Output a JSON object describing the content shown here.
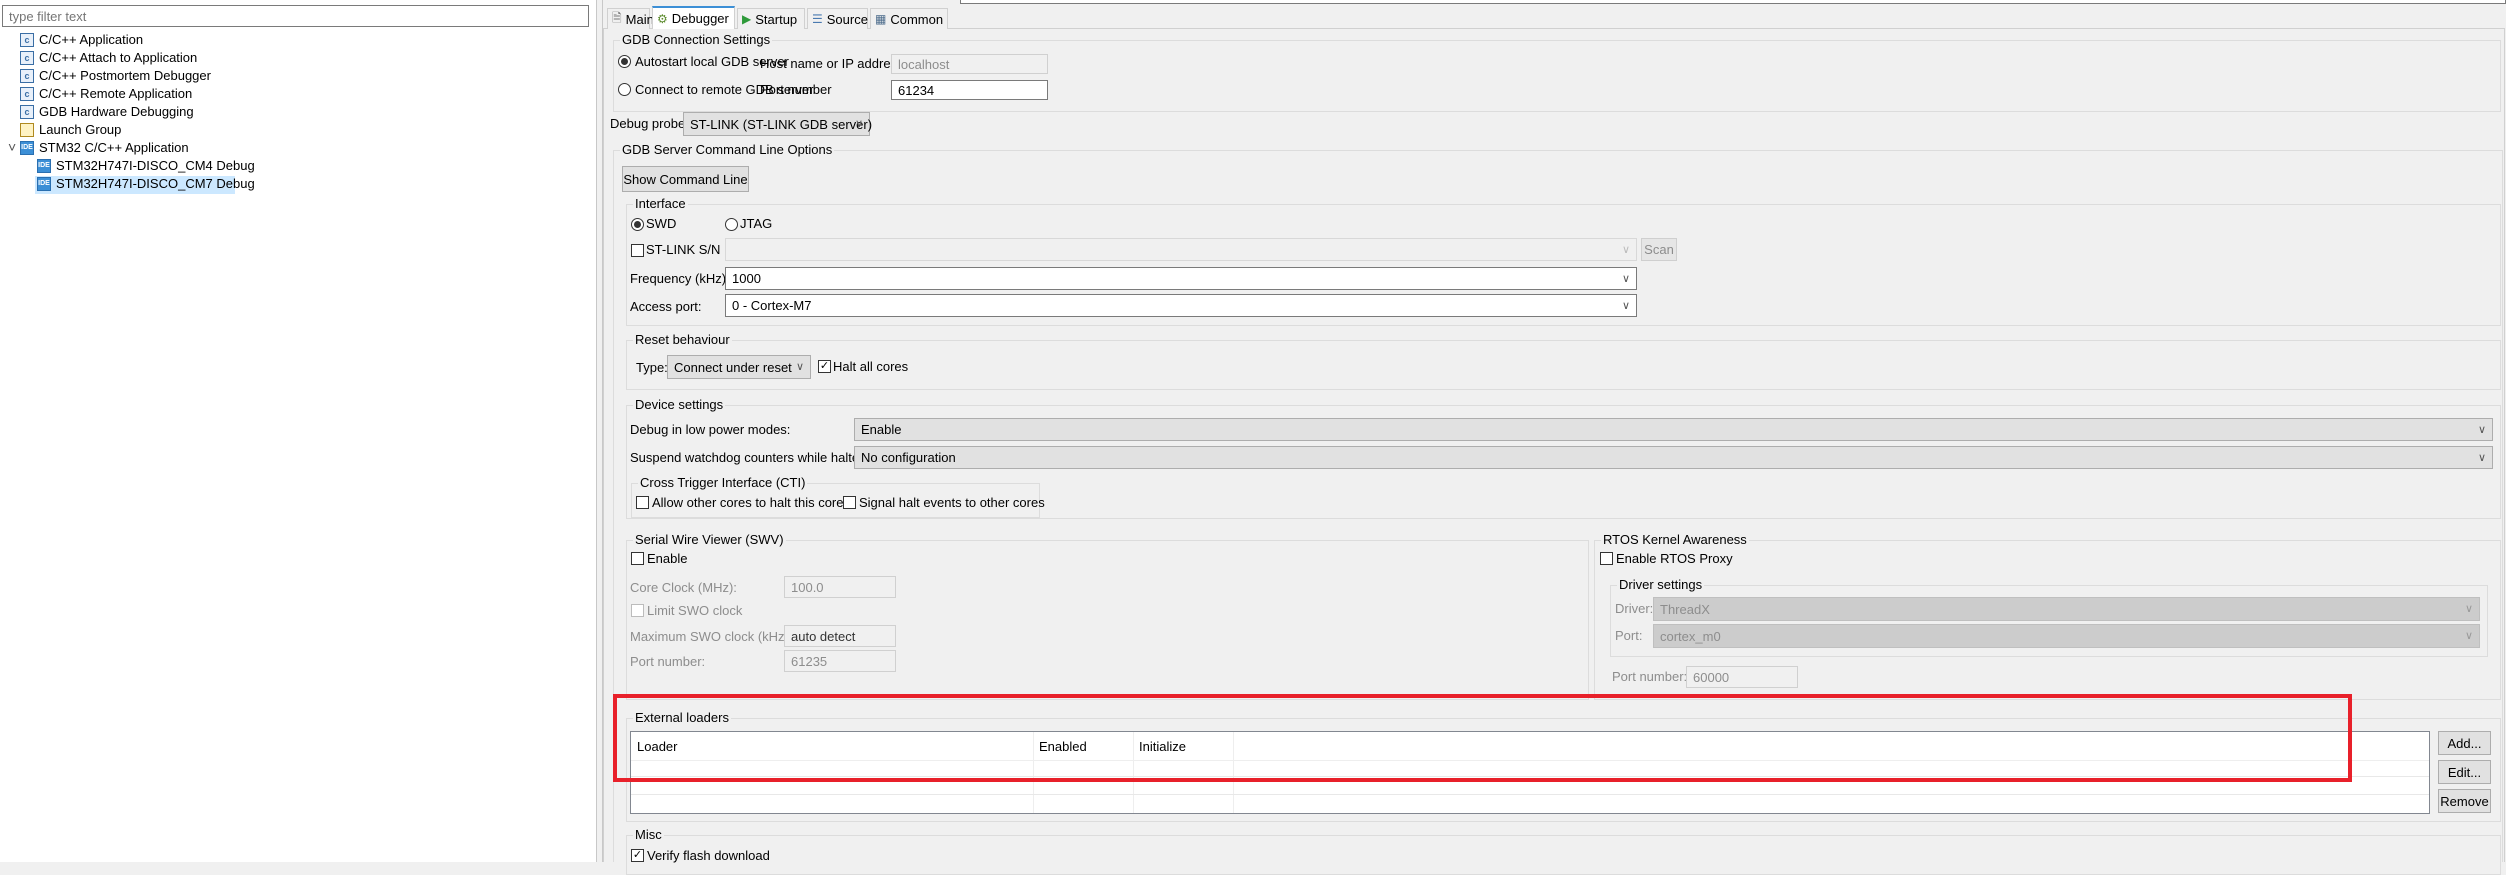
{
  "left": {
    "filter_placeholder": "type filter text",
    "tree": [
      {
        "label": "C/C++ Application",
        "icon": "c-launch-icon"
      },
      {
        "label": "C/C++ Attach to Application",
        "icon": "c-launch-icon"
      },
      {
        "label": "C/C++ Postmortem Debugger",
        "icon": "c-launch-icon"
      },
      {
        "label": "C/C++ Remote Application",
        "icon": "c-launch-icon"
      },
      {
        "label": "GDB Hardware Debugging",
        "icon": "c-launch-icon"
      },
      {
        "label": "Launch Group",
        "icon": "launch-group-icon"
      },
      {
        "label": "STM32 C/C++ Application",
        "icon": "stm32-icon",
        "expanded": true
      },
      {
        "label": "STM32H747I-DISCO_CM4 Debug",
        "icon": "stm32-icon"
      },
      {
        "label": "STM32H747I-DISCO_CM7 Debug",
        "icon": "stm32-icon",
        "selected": true
      }
    ],
    "icon_text": {
      "c": "c",
      "ide": "IDE"
    }
  },
  "tabs": [
    {
      "label": "Main",
      "icon": "document-icon"
    },
    {
      "label": "Debugger",
      "icon": "bug-icon",
      "active": true
    },
    {
      "label": "Startup",
      "icon": "play-icon"
    },
    {
      "label": "Source",
      "icon": "source-icon"
    },
    {
      "label": "Common",
      "icon": "table-icon"
    }
  ],
  "gdb": {
    "title": "GDB Connection Settings",
    "autostart": "Autostart local GDB server",
    "autostart_checked": true,
    "remote": "Connect to remote GDB server",
    "host_label": "Host name or IP address",
    "host_value": "localhost",
    "port_label": "Port number",
    "port_value": "61234"
  },
  "probe": {
    "label": "Debug probe",
    "value": "ST-LINK (ST-LINK GDB server)"
  },
  "cmdline": {
    "title": "GDB Server Command Line Options",
    "show_button": "Show Command Line"
  },
  "interface": {
    "title": "Interface",
    "swd": "SWD",
    "jtag": "JTAG",
    "selected": "SWD",
    "sn_label": "ST-LINK S/N",
    "sn_value": "",
    "scan": "Scan",
    "freq_label": "Frequency (kHz):",
    "freq_value": "1000",
    "ap_label": "Access port:",
    "ap_value": "0 - Cortex-M7"
  },
  "reset": {
    "title": "Reset behaviour",
    "type_label": "Type:",
    "type_value": "Connect under reset",
    "halt_all": "Halt all cores",
    "halt_all_checked": true
  },
  "device": {
    "title": "Device settings",
    "low_power_label": "Debug in low power modes:",
    "low_power_value": "Enable",
    "watchdog_label": "Suspend watchdog counters while halted:",
    "watchdog_value": "No configuration",
    "cti_title": "Cross Trigger Interface (CTI)",
    "cti_allow": "Allow other cores to halt this core",
    "cti_signal": "Signal halt events to other cores"
  },
  "swv": {
    "title": "Serial Wire Viewer (SWV)",
    "enable": "Enable",
    "core_clock_label": "Core Clock (MHz):",
    "core_clock_value": "100.0",
    "limit": "Limit SWO clock",
    "max_label": "Maximum SWO clock (kHz):",
    "max_value": "auto detect",
    "port_label": "Port number:",
    "port_value": "61235"
  },
  "rtos": {
    "title": "RTOS Kernel Awareness",
    "enable": "Enable RTOS Proxy",
    "driver_title": "Driver settings",
    "driver_label": "Driver:",
    "driver_value": "ThreadX",
    "port_label": "Port:",
    "port_value": "cortex_m0",
    "port_number_label": "Port number:",
    "port_number_value": "60000"
  },
  "loaders": {
    "title": "External loaders",
    "columns": [
      "Loader",
      "Enabled",
      "Initialize"
    ],
    "add": "Add...",
    "edit": "Edit...",
    "remove": "Remove"
  },
  "misc": {
    "title": "Misc",
    "verify": "Verify flash download",
    "verify_checked": true
  },
  "colors": {
    "highlight": "#e8202a",
    "selection": "#cce8ff",
    "accent": "#3c8fd6"
  }
}
